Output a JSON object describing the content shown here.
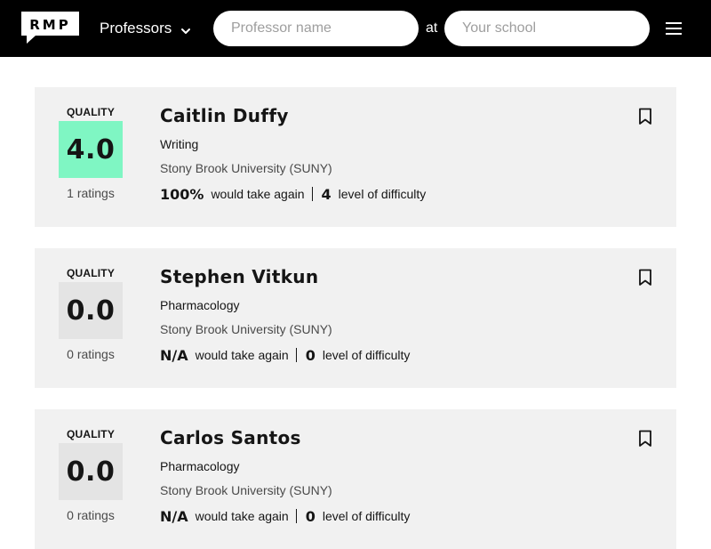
{
  "header": {
    "logo_text": "RMP",
    "search_type": "Professors",
    "professor_placeholder": "Professor name",
    "at_label": "at",
    "school_placeholder": "Your school"
  },
  "colors": {
    "header_bg": "#000000",
    "card_bg": "#f1f1f1",
    "quality_high": "#7ff6c3",
    "quality_none": "#e4e4e4"
  },
  "professors": [
    {
      "quality_label": "QUALITY",
      "score": "4.0",
      "score_color": "#7ff6c3",
      "ratings": "1 ratings",
      "name": "Caitlin Duffy",
      "department": "Writing",
      "school": "Stony Brook University (SUNY)",
      "would_take_again": "100%",
      "would_take_again_label": "would take again",
      "difficulty": "4",
      "difficulty_label": "level of difficulty"
    },
    {
      "quality_label": "QUALITY",
      "score": "0.0",
      "score_color": "#e4e4e4",
      "ratings": "0 ratings",
      "name": "Stephen Vitkun",
      "department": "Pharmacology",
      "school": "Stony Brook University (SUNY)",
      "would_take_again": "N/A",
      "would_take_again_label": "would take again",
      "difficulty": "0",
      "difficulty_label": "level of difficulty"
    },
    {
      "quality_label": "QUALITY",
      "score": "0.0",
      "score_color": "#e4e4e4",
      "ratings": "0 ratings",
      "name": "Carlos Santos",
      "department": "Pharmacology",
      "school": "Stony Brook University (SUNY)",
      "would_take_again": "N/A",
      "would_take_again_label": "would take again",
      "difficulty": "0",
      "difficulty_label": "level of difficulty"
    }
  ]
}
